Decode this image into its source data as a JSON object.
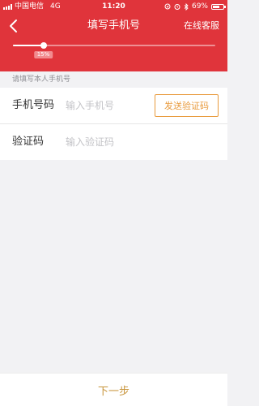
{
  "status_bar": {
    "carrier": "中国电信",
    "network": "4G",
    "time": "11:20",
    "battery": "69%",
    "battery_level": 0.69
  },
  "nav": {
    "title": "填写手机号",
    "right_label": "在线客服"
  },
  "progress": {
    "value": 0.15,
    "label": "15%"
  },
  "form": {
    "hint": "请填写本人手机号",
    "phone_label": "手机号码",
    "phone_placeholder": "输入手机号",
    "phone_value": "",
    "send_code_label": "发送验证码",
    "code_label": "验证码",
    "code_placeholder": "输入验证码",
    "code_value": ""
  },
  "footer": {
    "next_label": "下一步"
  },
  "colors": {
    "header_bg": "#e0343b",
    "send_code": "#e89a3c",
    "next": "#c8953c"
  }
}
